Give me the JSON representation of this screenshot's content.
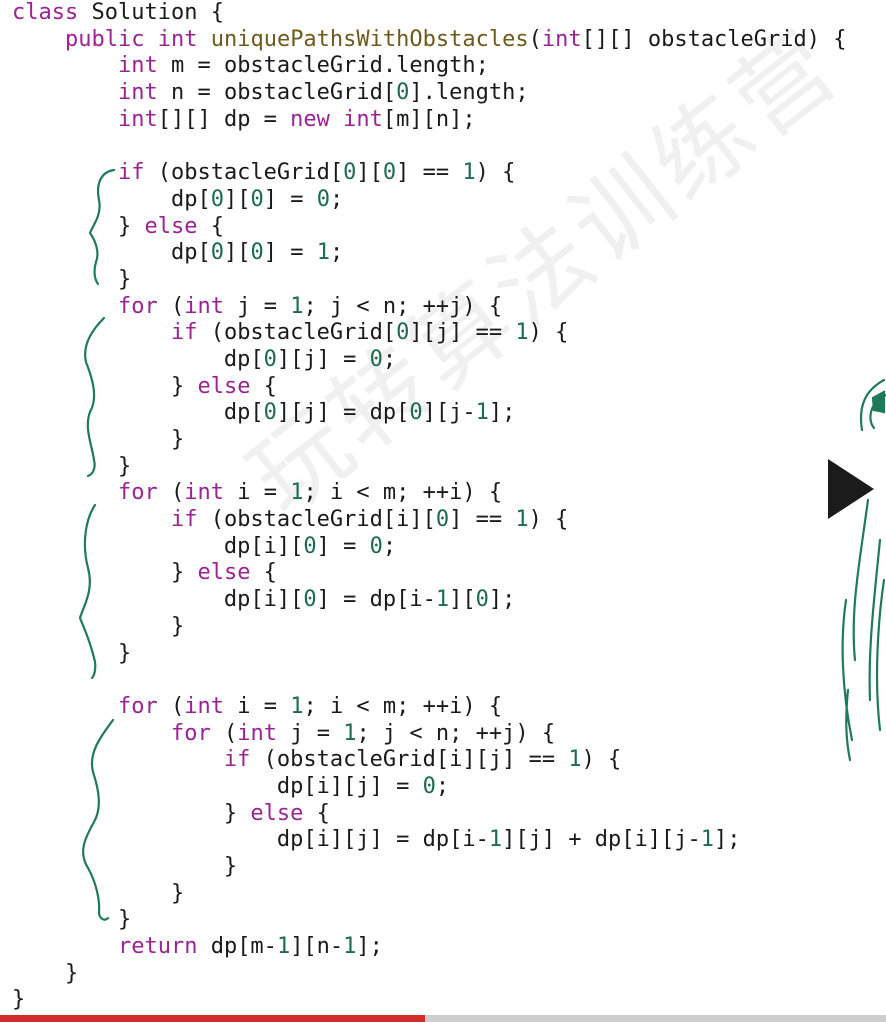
{
  "watermark_text": "玩转算法训练营",
  "colors": {
    "keyword": "#9b2393",
    "function_name": "#6e5a1c",
    "number": "#1c6b4e",
    "plain": "#1a1a1a",
    "annotation": "#1f7a57",
    "progress_played": "#d22b2b",
    "progress_track": "#cfcfcf"
  },
  "player": {
    "play_icon": "play-icon",
    "progress_fraction": 0.48
  },
  "code_lines": [
    [
      [
        "kw",
        "class"
      ],
      [
        "sp",
        " "
      ],
      [
        "id",
        "Solution {"
      ]
    ],
    [
      [
        "sp",
        "    "
      ],
      [
        "kw",
        "public"
      ],
      [
        "sp",
        " "
      ],
      [
        "kw",
        "int"
      ],
      [
        "sp",
        " "
      ],
      [
        "fn",
        "uniquePathsWithObstacles"
      ],
      [
        "id",
        "("
      ],
      [
        "kw",
        "int"
      ],
      [
        "id",
        "[][] obstacleGrid) {"
      ]
    ],
    [
      [
        "sp",
        "        "
      ],
      [
        "kw",
        "int"
      ],
      [
        "id",
        " m = obstacleGrid.length;"
      ]
    ],
    [
      [
        "sp",
        "        "
      ],
      [
        "kw",
        "int"
      ],
      [
        "id",
        " n = obstacleGrid["
      ],
      [
        "num",
        "0"
      ],
      [
        "id",
        "].length;"
      ]
    ],
    [
      [
        "sp",
        "        "
      ],
      [
        "kw",
        "int"
      ],
      [
        "id",
        "[][] dp = "
      ],
      [
        "kw",
        "new"
      ],
      [
        "sp",
        " "
      ],
      [
        "kw",
        "int"
      ],
      [
        "id",
        "[m][n];"
      ]
    ],
    [],
    [
      [
        "sp",
        "        "
      ],
      [
        "kw",
        "if"
      ],
      [
        "id",
        " (obstacleGrid["
      ],
      [
        "num",
        "0"
      ],
      [
        "id",
        "]["
      ],
      [
        "num",
        "0"
      ],
      [
        "id",
        "] == "
      ],
      [
        "num",
        "1"
      ],
      [
        "id",
        ") {"
      ]
    ],
    [
      [
        "sp",
        "            "
      ],
      [
        "id",
        "dp["
      ],
      [
        "num",
        "0"
      ],
      [
        "id",
        "]["
      ],
      [
        "num",
        "0"
      ],
      [
        "id",
        "] = "
      ],
      [
        "num",
        "0"
      ],
      [
        "id",
        ";"
      ]
    ],
    [
      [
        "sp",
        "        "
      ],
      [
        "id",
        "} "
      ],
      [
        "kw",
        "else"
      ],
      [
        "id",
        " {"
      ]
    ],
    [
      [
        "sp",
        "            "
      ],
      [
        "id",
        "dp["
      ],
      [
        "num",
        "0"
      ],
      [
        "id",
        "]["
      ],
      [
        "num",
        "0"
      ],
      [
        "id",
        "] = "
      ],
      [
        "num",
        "1"
      ],
      [
        "id",
        ";"
      ]
    ],
    [
      [
        "sp",
        "        "
      ],
      [
        "id",
        "}"
      ]
    ],
    [
      [
        "sp",
        "        "
      ],
      [
        "kw",
        "for"
      ],
      [
        "id",
        " ("
      ],
      [
        "kw",
        "int"
      ],
      [
        "id",
        " j = "
      ],
      [
        "num",
        "1"
      ],
      [
        "id",
        "; j < n; ++j) {"
      ]
    ],
    [
      [
        "sp",
        "            "
      ],
      [
        "kw",
        "if"
      ],
      [
        "id",
        " (obstacleGrid["
      ],
      [
        "num",
        "0"
      ],
      [
        "id",
        "][j] == "
      ],
      [
        "num",
        "1"
      ],
      [
        "id",
        ") {"
      ]
    ],
    [
      [
        "sp",
        "                "
      ],
      [
        "id",
        "dp["
      ],
      [
        "num",
        "0"
      ],
      [
        "id",
        "][j] = "
      ],
      [
        "num",
        "0"
      ],
      [
        "id",
        ";"
      ]
    ],
    [
      [
        "sp",
        "            "
      ],
      [
        "id",
        "} "
      ],
      [
        "kw",
        "else"
      ],
      [
        "id",
        " {"
      ]
    ],
    [
      [
        "sp",
        "                "
      ],
      [
        "id",
        "dp["
      ],
      [
        "num",
        "0"
      ],
      [
        "id",
        "][j] = dp["
      ],
      [
        "num",
        "0"
      ],
      [
        "id",
        "][j-"
      ],
      [
        "num",
        "1"
      ],
      [
        "id",
        "];"
      ]
    ],
    [
      [
        "sp",
        "            "
      ],
      [
        "id",
        "}"
      ]
    ],
    [
      [
        "sp",
        "        "
      ],
      [
        "id",
        "}"
      ]
    ],
    [
      [
        "sp",
        "        "
      ],
      [
        "kw",
        "for"
      ],
      [
        "id",
        " ("
      ],
      [
        "kw",
        "int"
      ],
      [
        "id",
        " i = "
      ],
      [
        "num",
        "1"
      ],
      [
        "id",
        "; i < m; ++i) {"
      ]
    ],
    [
      [
        "sp",
        "            "
      ],
      [
        "kw",
        "if"
      ],
      [
        "id",
        " (obstacleGrid[i]["
      ],
      [
        "num",
        "0"
      ],
      [
        "id",
        "] == "
      ],
      [
        "num",
        "1"
      ],
      [
        "id",
        ") {"
      ]
    ],
    [
      [
        "sp",
        "                "
      ],
      [
        "id",
        "dp[i]["
      ],
      [
        "num",
        "0"
      ],
      [
        "id",
        "] = "
      ],
      [
        "num",
        "0"
      ],
      [
        "id",
        ";"
      ]
    ],
    [
      [
        "sp",
        "            "
      ],
      [
        "id",
        "} "
      ],
      [
        "kw",
        "else"
      ],
      [
        "id",
        " {"
      ]
    ],
    [
      [
        "sp",
        "                "
      ],
      [
        "id",
        "dp[i]["
      ],
      [
        "num",
        "0"
      ],
      [
        "id",
        "] = dp[i-"
      ],
      [
        "num",
        "1"
      ],
      [
        "id",
        "]["
      ],
      [
        "num",
        "0"
      ],
      [
        "id",
        "];"
      ]
    ],
    [
      [
        "sp",
        "            "
      ],
      [
        "id",
        "}"
      ]
    ],
    [
      [
        "sp",
        "        "
      ],
      [
        "id",
        "}"
      ]
    ],
    [],
    [
      [
        "sp",
        "        "
      ],
      [
        "kw",
        "for"
      ],
      [
        "id",
        " ("
      ],
      [
        "kw",
        "int"
      ],
      [
        "id",
        " i = "
      ],
      [
        "num",
        "1"
      ],
      [
        "id",
        "; i < m; ++i) {"
      ]
    ],
    [
      [
        "sp",
        "            "
      ],
      [
        "kw",
        "for"
      ],
      [
        "id",
        " ("
      ],
      [
        "kw",
        "int"
      ],
      [
        "id",
        " j = "
      ],
      [
        "num",
        "1"
      ],
      [
        "id",
        "; j < n; ++j) {"
      ]
    ],
    [
      [
        "sp",
        "                "
      ],
      [
        "kw",
        "if"
      ],
      [
        "id",
        " (obstacleGrid[i][j] == "
      ],
      [
        "num",
        "1"
      ],
      [
        "id",
        ") {"
      ]
    ],
    [
      [
        "sp",
        "                    "
      ],
      [
        "id",
        "dp[i][j] = "
      ],
      [
        "num",
        "0"
      ],
      [
        "id",
        ";"
      ]
    ],
    [
      [
        "sp",
        "                "
      ],
      [
        "id",
        "} "
      ],
      [
        "kw",
        "else"
      ],
      [
        "id",
        " {"
      ]
    ],
    [
      [
        "sp",
        "                    "
      ],
      [
        "id",
        "dp[i][j] = dp[i-"
      ],
      [
        "num",
        "1"
      ],
      [
        "id",
        "][j] + dp[i][j-"
      ],
      [
        "num",
        "1"
      ],
      [
        "id",
        "];"
      ]
    ],
    [
      [
        "sp",
        "                "
      ],
      [
        "id",
        "}"
      ]
    ],
    [
      [
        "sp",
        "            "
      ],
      [
        "id",
        "}"
      ]
    ],
    [
      [
        "sp",
        "        "
      ],
      [
        "id",
        "}"
      ]
    ],
    [
      [
        "sp",
        "        "
      ],
      [
        "kw",
        "return"
      ],
      [
        "id",
        " dp[m-"
      ],
      [
        "num",
        "1"
      ],
      [
        "id",
        "][n-"
      ],
      [
        "num",
        "1"
      ],
      [
        "id",
        "];"
      ]
    ],
    [
      [
        "sp",
        "    "
      ],
      [
        "id",
        "}"
      ]
    ],
    [
      [
        "id",
        "}"
      ]
    ]
  ]
}
